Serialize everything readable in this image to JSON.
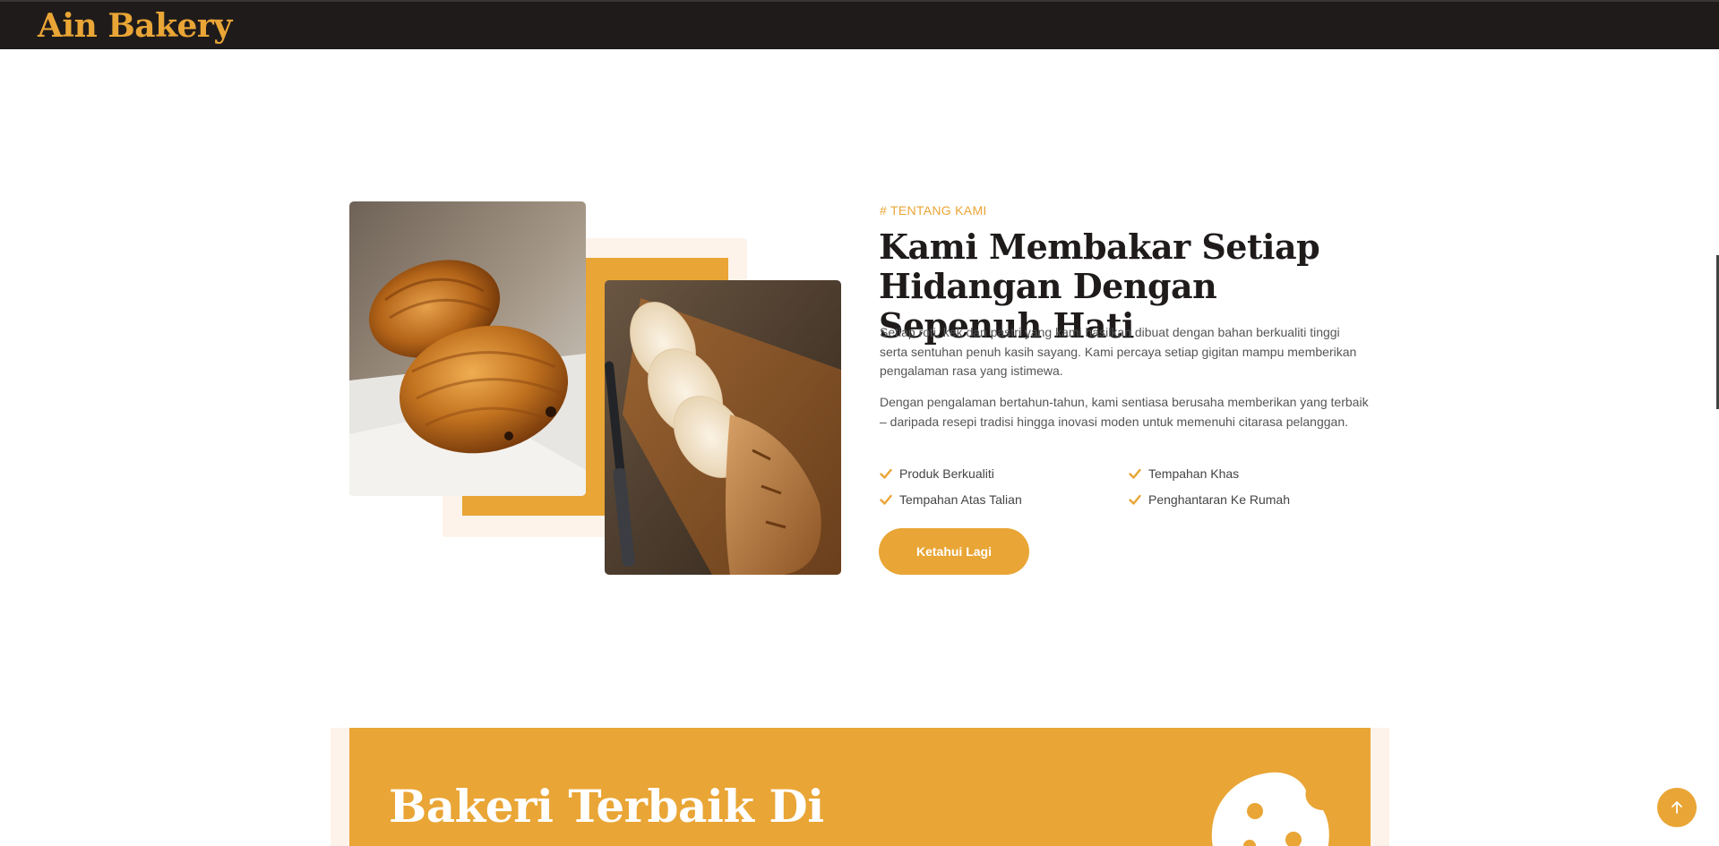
{
  "brand": {
    "name": "Ain Bakery"
  },
  "about": {
    "eyebrow": "# TENTANG KAMI",
    "heading": "Kami Membakar Setiap Hidangan Dengan Sepenuh Hati",
    "paragraph1": "Setiap roti, kek dan pastri yang kami hasilkan dibuat dengan bahan berkualiti tinggi serta sentuhan penuh kasih sayang. Kami percaya setiap gigitan mampu memberikan pengalaman rasa yang istimewa.",
    "paragraph2": "Dengan pengalaman bertahun-tahun, kami sentiasa berusaha memberikan yang terbaik – daripada resepi tradisi hingga inovasi moden untuk memenuhi citarasa pelanggan.",
    "features": [
      "Produk Berkualiti",
      "Tempahan Khas",
      "Tempahan Atas Talian",
      "Penghantaran Ke Rumah"
    ],
    "button_label": "Ketahui Lagi",
    "images": [
      "croissant-photo",
      "sliced-bread-photo"
    ]
  },
  "banner": {
    "title": "Bakeri Terbaik Di"
  },
  "icons": {
    "check": "check-icon",
    "back_to_top": "arrow-up-icon",
    "cookie": "cookie-icon"
  },
  "colors": {
    "accent": "#e9a535",
    "dark": "#1f1b1b",
    "cream": "#fdf3ea"
  }
}
